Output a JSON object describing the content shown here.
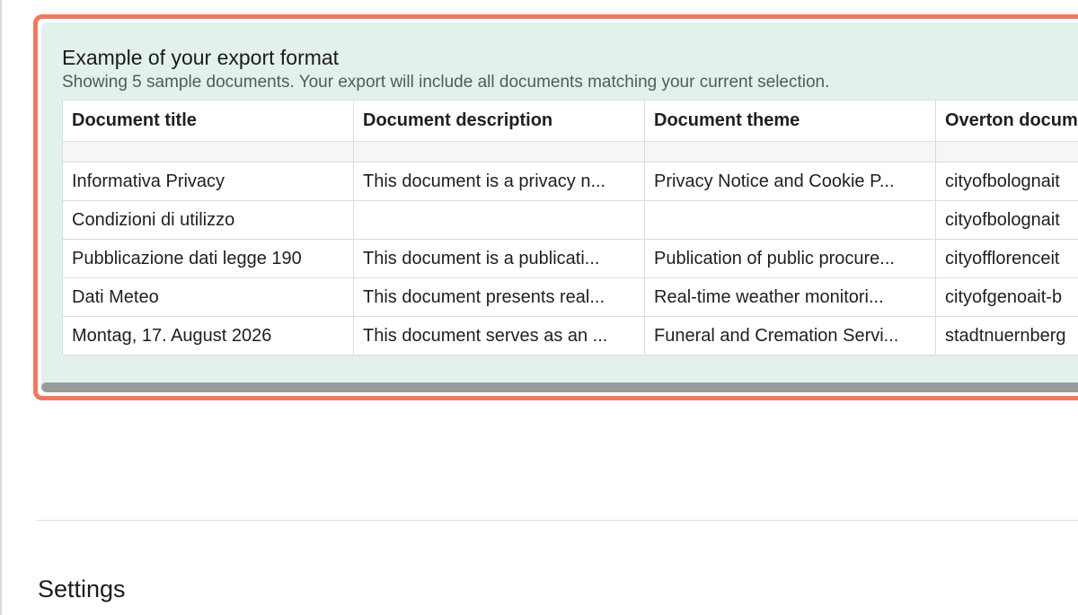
{
  "export_preview": {
    "title": "Example of your export format",
    "subtitle": "Showing 5 sample documents. Your export will include all documents matching your current selection.",
    "columns": [
      "Document title",
      "Document description",
      "Document theme",
      "Overton docum"
    ],
    "rows": [
      [
        "Informativa Privacy",
        "This document is a privacy n...",
        "Privacy Notice and Cookie P...",
        "cityofbolognait"
      ],
      [
        "Condizioni di utilizzo",
        "",
        "",
        "cityofbolognait"
      ],
      [
        "Pubblicazione dati legge 190",
        "This document is a publicati...",
        "Publication of public procure...",
        "cityofflorenceit"
      ],
      [
        "Dati Meteo",
        "This document presents real...",
        "Real-time weather monitori...",
        "cityofgenoait-b"
      ],
      [
        "Montag, 17. August 2026",
        "This document serves as an ...",
        "Funeral and Cremation Servi...",
        "stadtnuernberg"
      ]
    ]
  },
  "settings": {
    "heading": "Settings"
  },
  "colors": {
    "highlight_border": "#f07860",
    "panel_background": "#e3f1ed"
  }
}
